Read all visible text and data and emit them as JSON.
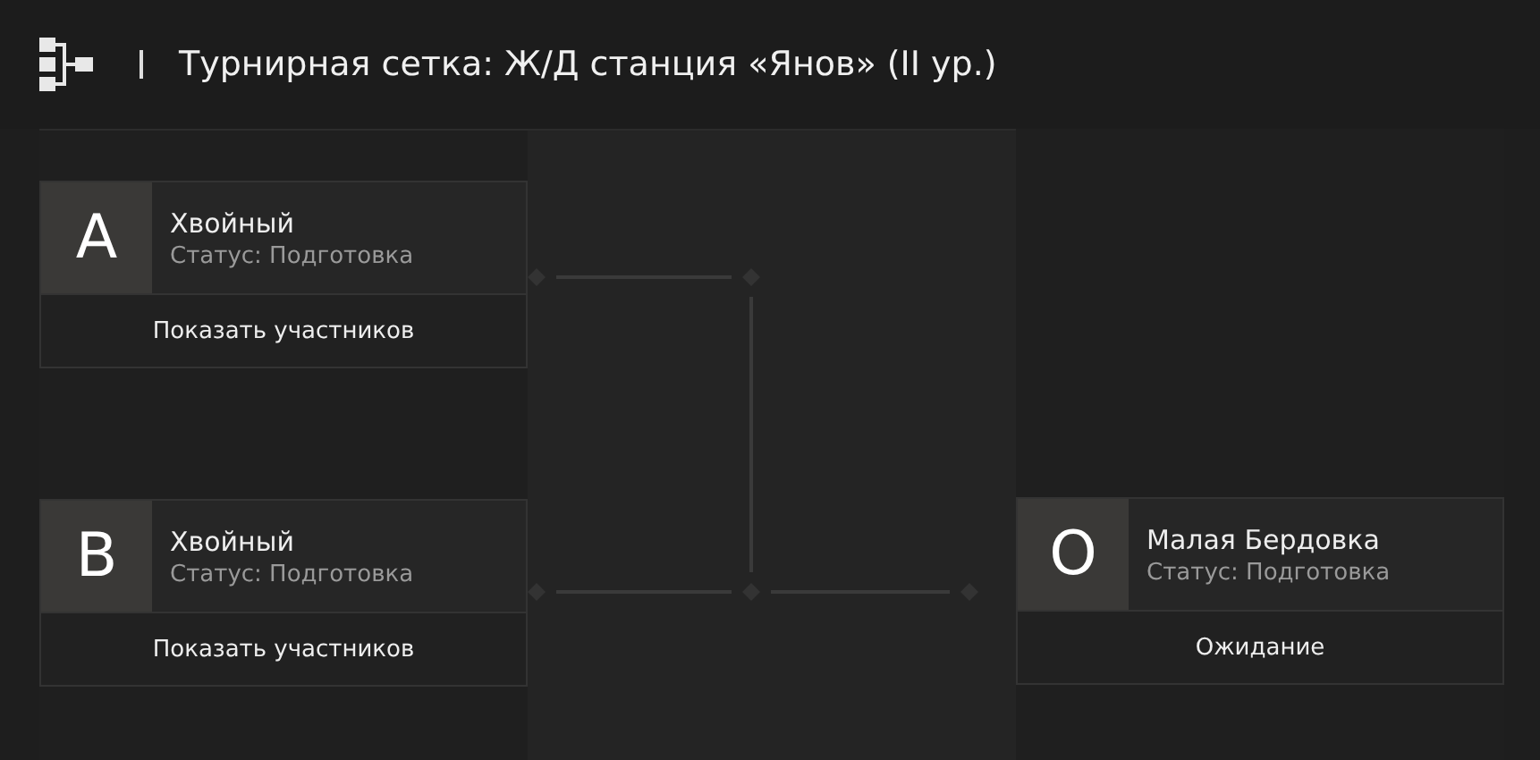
{
  "header": {
    "title": "Турнирная сетка: Ж/Д станция «Янов» (II ур.)"
  },
  "rounds": [
    {
      "cards": [
        {
          "letter": "A",
          "name": "Хвойный",
          "status": "Статус: Подготовка",
          "action": "Показать участников"
        },
        {
          "letter": "B",
          "name": "Хвойный",
          "status": "Статус: Подготовка",
          "action": "Показать участников"
        }
      ]
    },
    {
      "cards": [
        {
          "letter": "O",
          "name": "Малая Бердовка",
          "status": "Статус: Подготовка",
          "action": "Ожидание"
        }
      ]
    }
  ]
}
